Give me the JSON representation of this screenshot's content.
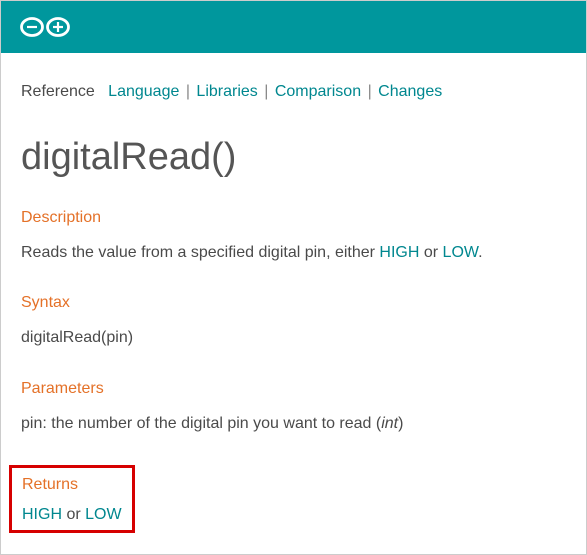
{
  "breadcrumb": {
    "label": "Reference",
    "links": {
      "language": "Language",
      "libraries": "Libraries",
      "comparison": "Comparison",
      "changes": "Changes"
    },
    "sep": "|"
  },
  "page": {
    "title": "digitalRead()"
  },
  "sections": {
    "description": {
      "heading": "Description",
      "text_prefix": "Reads the value from a specified digital pin, either ",
      "high": "HIGH",
      "or": " or ",
      "low": "LOW",
      "period": "."
    },
    "syntax": {
      "heading": "Syntax",
      "text": "digitalRead(pin)"
    },
    "parameters": {
      "heading": "Parameters",
      "text_prefix": "pin: the number of the digital pin you want to read (",
      "italic": "int",
      "suffix": ")"
    },
    "returns": {
      "heading": "Returns",
      "high": "HIGH",
      "or": " or ",
      "low": "LOW"
    }
  }
}
